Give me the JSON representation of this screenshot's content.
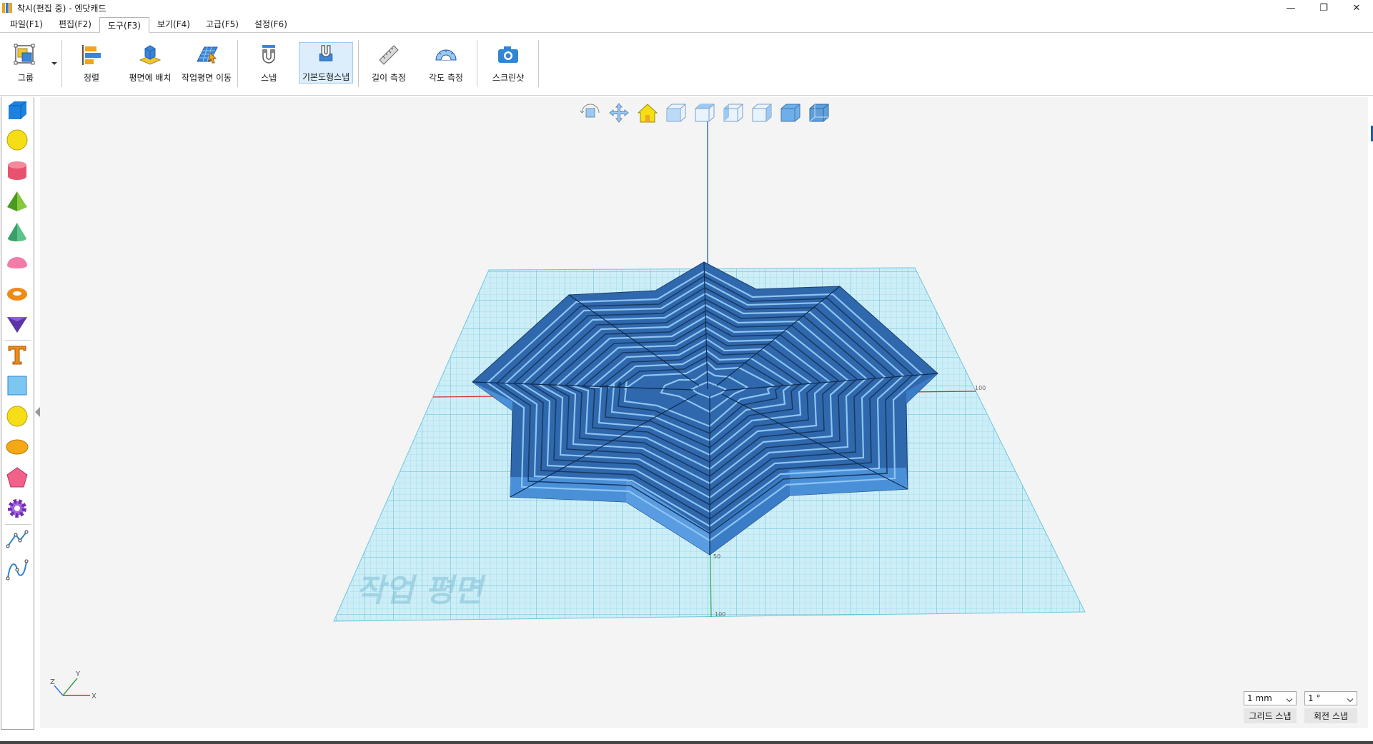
{
  "window": {
    "title": "착시(편집 중) - 엔닷캐드",
    "controls": {
      "minimize": "—",
      "maximize": "❐",
      "close": "✕"
    }
  },
  "menu": {
    "items": [
      "파일(F1)",
      "편집(F2)",
      "도구(F3)",
      "보기(F4)",
      "고급(F5)",
      "설정(F6)"
    ],
    "active_index": 2
  },
  "ribbon": {
    "group": "그룹",
    "align": "정렬",
    "place_on_plane": "평면에 배치",
    "move_workplane": "작업평면 이동",
    "snap": "스냅",
    "primitive_snap": "기본도형스냅",
    "measure_length": "길이 측정",
    "measure_angle": "각도 측정",
    "screenshot": "스크린샷",
    "active_button": "primitive_snap"
  },
  "left_toolbar": {
    "icons": [
      "box-icon",
      "sphere-icon",
      "cylinder-icon",
      "pyramid-icon",
      "cone-icon",
      "hemisphere-icon",
      "torus-icon",
      "prism-icon",
      "text-icon",
      "rectangle-icon",
      "circle-icon",
      "ellipse-icon",
      "polygon-icon",
      "gear-icon",
      "polyline-icon",
      "curve-icon"
    ]
  },
  "viewport": {
    "workplane_label": "작업 평면",
    "axis_tick_x": "100",
    "axis_tick_y_near": "50",
    "axis_tick_y_far": "100",
    "axes_gizmo": {
      "x": "X",
      "y": "Y",
      "z": "Z"
    },
    "nav_icons": [
      "orbit-icon",
      "pan-icon",
      "home-icon",
      "view-front-icon",
      "view-top-icon",
      "view-left-icon",
      "view-right-icon",
      "view-back-icon",
      "view-iso-icon"
    ]
  },
  "snap": {
    "grid_value": "1 mm",
    "grid_label": "그리드 스냅",
    "rotate_value": "1 °",
    "rotate_label": "회전 스냅"
  },
  "colors": {
    "shape_blue": "#3c7ec6",
    "grid_line": "#6fc7de",
    "grid_bg": "#c9ecf6",
    "z_axis": "#2f73d0",
    "x_axis": "#d03030",
    "y_axis": "#2fa14a"
  }
}
